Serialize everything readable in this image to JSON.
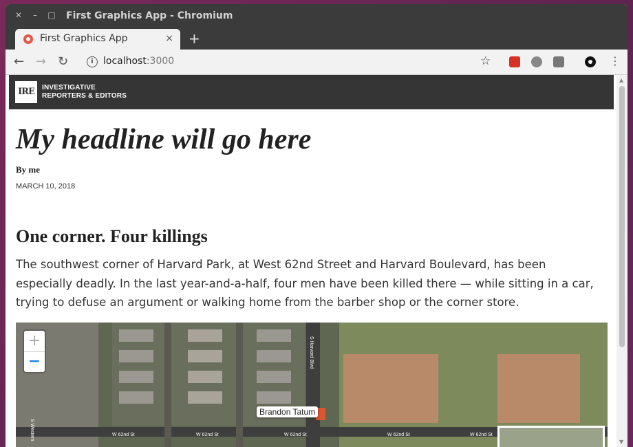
{
  "window": {
    "title": "First Graphics App - Chromium"
  },
  "tab": {
    "title": "First Graphics App",
    "close": "×",
    "new_tab": "+"
  },
  "toolbar": {
    "back": "←",
    "forward": "→",
    "reload": "↻",
    "url_host": "localhost",
    "url_port": ":3000",
    "star": "☆"
  },
  "site": {
    "logo_text": "IRE",
    "org_line1": "INVESTIGATIVE",
    "org_line2": "REPORTERS & EDITORS",
    "headline": "My headline will go here",
    "byline": "By me",
    "date": "MARCH 10, 2018",
    "subhead": "One corner. Four killings",
    "body": "The southwest corner of Harvard Park, at West 62nd Street and Harvard Boulevard, has been especially deadly. In the last year-and-a-half, four men have been killed there — while sitting in a car, trying to defuse an argument or walking home from the barber shop or the corner store."
  },
  "map": {
    "zoom_in": "+",
    "zoom_out": "−",
    "tooltip": "Brandon Tatum",
    "road_labels": [
      "W 62nd St",
      "W 62nd St",
      "W 62nd St",
      "W 62nd St",
      "W 62nd St",
      "S Harvard Blvd",
      "S Western"
    ]
  },
  "colors": {
    "header": "#353535",
    "titlebar": "#3b3b3b",
    "marker": "#e8552e",
    "zoom_active": "#1e88e5"
  }
}
